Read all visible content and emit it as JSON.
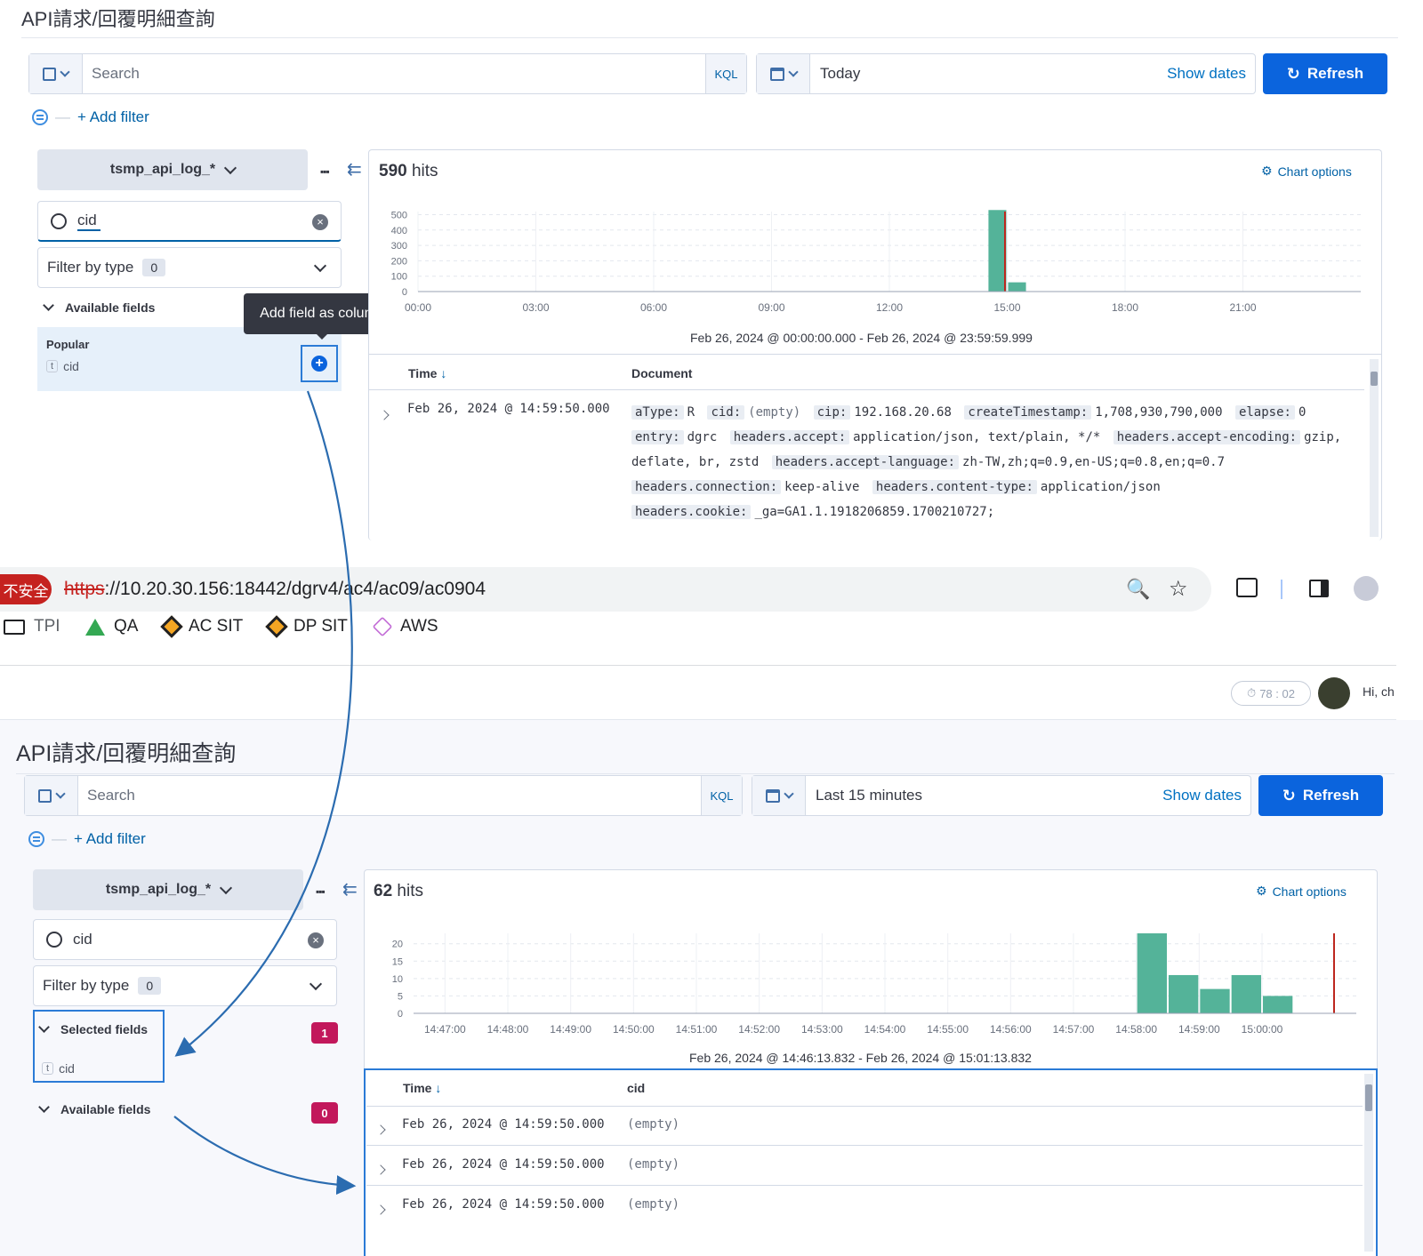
{
  "top": {
    "page_title": "API請求/回覆明細查詢",
    "search_placeholder": "Search",
    "kql": "KQL",
    "date_value": "Today",
    "show_dates": "Show dates",
    "refresh": "Refresh",
    "add_filter": "+ Add filter",
    "index_pattern": "tsmp_api_log_*",
    "field_search_value": "cid",
    "filter_by_type": "Filter by type",
    "filter_count": "0",
    "available_fields": "Available fields",
    "popular": "Popular",
    "popular_field": "cid",
    "field_type_token": "t",
    "tooltip": "Add field as column",
    "hits_count": "590",
    "hits_label": "hits",
    "chart_options": "Chart options",
    "range_text": "Feb 26, 2024 @ 00:00:00.000 - Feb 26, 2024 @ 23:59:59.999",
    "col_time": "Time",
    "col_document": "Document",
    "row_time": "Feb 26, 2024 @ 14:59:50.000",
    "doc": {
      "atype_k": "aType:",
      "atype_v": "R",
      "cid_k": "cid:",
      "cid_v": "(empty)",
      "cip_k": "cip:",
      "cip_v": "192.168.20.68",
      "ct_k": "createTimestamp:",
      "ct_v": "1,708,930,790,000",
      "el_k": "elapse:",
      "el_v": "0",
      "entry_k": "entry:",
      "entry_v": "dgrc",
      "ha_k": "headers.accept:",
      "ha_v": "application/json, text/plain, */*",
      "hae_k": "headers.accept-encoding:",
      "hae_v": "gzip,",
      "hae_v2": "deflate, br, zstd",
      "hal_k": "headers.accept-language:",
      "hal_v": "zh-TW,zh;q=0.9,en-US;q=0.8,en;q=0.7",
      "hc_k": "headers.connection:",
      "hc_v": "keep-alive",
      "hct_k": "headers.content-type:",
      "hct_v": "application/json",
      "hck_k": "headers.cookie:",
      "hck_v": "_ga=GA1.1.1918206859.1700210727;"
    }
  },
  "browser": {
    "insecure": "不安全",
    "url_scheme": "https",
    "url_rest": "://10.20.30.156:18442/dgrv4/ac4/ac09/ac0904",
    "bookmarks": [
      "TPI",
      "QA",
      "AC SIT",
      "DP SIT",
      "AWS"
    ],
    "timer": "78 : 02",
    "greeting": "Hi, ch"
  },
  "bottom": {
    "page_title": "API請求/回覆明細查詢",
    "search_placeholder": "Search",
    "kql": "KQL",
    "date_value": "Last 15 minutes",
    "show_dates": "Show dates",
    "refresh": "Refresh",
    "add_filter": "+ Add filter",
    "index_pattern": "tsmp_api_log_*",
    "field_search_value": "cid",
    "filter_by_type": "Filter by type",
    "filter_count": "0",
    "selected_fields": "Selected fields",
    "selected_count": "1",
    "selected_field": "cid",
    "field_type_token": "t",
    "available_fields": "Available fields",
    "available_count": "0",
    "hits_count": "62",
    "hits_label": "hits",
    "chart_options": "Chart options",
    "range_text": "Feb 26, 2024 @ 14:46:13.832 - Feb 26, 2024 @ 15:01:13.832",
    "col_time": "Time",
    "col_cid": "cid",
    "rows": [
      {
        "time": "Feb 26, 2024 @ 14:59:50.000",
        "cid": "(empty)"
      },
      {
        "time": "Feb 26, 2024 @ 14:59:50.000",
        "cid": "(empty)"
      },
      {
        "time": "Feb 26, 2024 @ 14:59:50.000",
        "cid": "(empty)"
      }
    ]
  },
  "chart_data": [
    {
      "type": "bar",
      "categories": [
        "00:00",
        "00:30",
        "01:00",
        "01:30",
        "02:00",
        "02:30",
        "03:00",
        "03:30",
        "04:00",
        "04:30",
        "05:00",
        "05:30",
        "06:00",
        "06:30",
        "07:00",
        "07:30",
        "08:00",
        "08:30",
        "09:00",
        "09:30",
        "10:00",
        "10:30",
        "11:00",
        "11:30",
        "12:00",
        "12:30",
        "13:00",
        "13:30",
        "14:00",
        "14:30",
        "15:00",
        "15:30",
        "16:00",
        "16:30",
        "17:00",
        "17:30",
        "18:00",
        "18:30",
        "19:00",
        "19:30",
        "20:00",
        "20:30",
        "21:00",
        "21:30",
        "22:00",
        "22:30",
        "23:00",
        "23:30"
      ],
      "values": [
        0,
        0,
        0,
        0,
        0,
        0,
        0,
        0,
        0,
        0,
        0,
        0,
        0,
        0,
        0,
        0,
        0,
        0,
        0,
        0,
        0,
        0,
        0,
        0,
        0,
        0,
        0,
        0,
        0,
        530,
        60,
        0,
        0,
        0,
        0,
        0,
        0,
        0,
        0,
        0,
        0,
        0,
        0,
        0,
        0,
        0,
        0,
        0
      ],
      "x_ticks": [
        "00:00",
        "03:00",
        "06:00",
        "09:00",
        "12:00",
        "15:00",
        "18:00",
        "21:00"
      ],
      "y_ticks": [
        0,
        100,
        200,
        300,
        400,
        500
      ],
      "ylim": [
        0,
        520
      ],
      "now_marker": "15:00",
      "bar_color": "#54b399",
      "marker_color": "#bd271e"
    },
    {
      "type": "bar",
      "categories": [
        "14:46:30",
        "14:47:00",
        "14:47:30",
        "14:48:00",
        "14:48:30",
        "14:49:00",
        "14:49:30",
        "14:50:00",
        "14:50:30",
        "14:51:00",
        "14:51:30",
        "14:52:00",
        "14:52:30",
        "14:53:00",
        "14:53:30",
        "14:54:00",
        "14:54:30",
        "14:55:00",
        "14:55:30",
        "14:56:00",
        "14:56:30",
        "14:57:00",
        "14:57:30",
        "14:58:00",
        "14:58:30",
        "14:59:00",
        "14:59:30",
        "15:00:00",
        "15:00:30",
        "15:01:00"
      ],
      "values": [
        0,
        0,
        0,
        0,
        0,
        0,
        0,
        0,
        0,
        0,
        0,
        0,
        0,
        0,
        0,
        0,
        0,
        0,
        0,
        0,
        0,
        0,
        0,
        23,
        11,
        7,
        11,
        5,
        0,
        0
      ],
      "x_ticks": [
        "14:47:00",
        "14:48:00",
        "14:49:00",
        "14:50:00",
        "14:51:00",
        "14:52:00",
        "14:53:00",
        "14:54:00",
        "14:55:00",
        "14:56:00",
        "14:57:00",
        "14:58:00",
        "14:59:00",
        "15:00:00"
      ],
      "y_ticks": [
        0,
        5,
        10,
        15,
        20
      ],
      "ylim": [
        0,
        23
      ],
      "now_marker": "15:01:13",
      "bar_color": "#54b399",
      "marker_color": "#bd271e"
    }
  ]
}
